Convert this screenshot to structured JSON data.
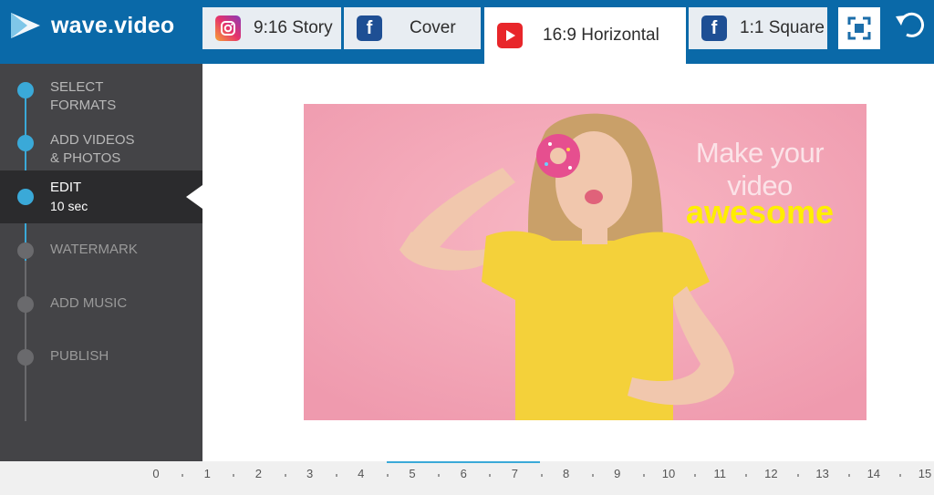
{
  "app": {
    "logo_text": "wave.video"
  },
  "tabs": [
    {
      "label": "9:16 Story",
      "icon": "instagram-icon"
    },
    {
      "label": "Cover",
      "icon": "facebook-icon"
    },
    {
      "label": "16:9 Horizontal",
      "icon": "youtube-icon",
      "active": true
    },
    {
      "label": "1:1 Square",
      "icon": "facebook-icon"
    }
  ],
  "toolbar": {
    "fullscreen_icon": "fullscreen-icon",
    "undo_icon": "undo-icon"
  },
  "steps": [
    {
      "line1": "SELECT",
      "line2": "FORMATS",
      "state": "done"
    },
    {
      "line1": "ADD VIDEOS",
      "line2": "& PHOTOS",
      "state": "done"
    },
    {
      "line1": "EDIT",
      "line2": "10 sec",
      "state": "current"
    },
    {
      "line1": "WATERMARK",
      "line2": "",
      "state": "todo"
    },
    {
      "line1": "ADD MUSIC",
      "line2": "",
      "state": "todo"
    },
    {
      "line1": "PUBLISH",
      "line2": "",
      "state": "todo"
    }
  ],
  "canvas": {
    "caption_line1": "Make your video",
    "caption_line2": "awesome",
    "background_color": "#f5a9b8",
    "caption_highlight_color": "#ffee00"
  },
  "timeline": {
    "ticks": [
      "0",
      "1",
      "2",
      "3",
      "4",
      "5",
      "6",
      "7",
      "8",
      "9",
      "10",
      "11",
      "12",
      "13",
      "14",
      "15"
    ],
    "accent": "#3aa9d8"
  },
  "colors": {
    "brand": "#0a69a8",
    "sidebar": "#444447",
    "accent": "#3aa9d8"
  }
}
